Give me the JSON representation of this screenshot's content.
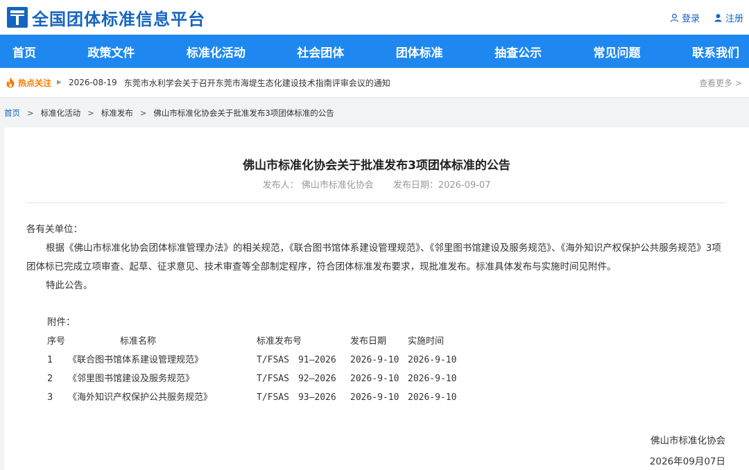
{
  "header": {
    "site_title": "全国团体标准信息平台",
    "login": "登录",
    "register": "注册"
  },
  "nav": [
    "首页",
    "政策文件",
    "标准化活动",
    "社会团体",
    "团体标准",
    "抽查公示",
    "常见问题",
    "联系我们"
  ],
  "hot": {
    "label": "热点关注",
    "date": "2026-08-19",
    "text": "东莞市水利学会关于召开东莞市海堤生态化建设技术指南评审会议的通知",
    "more": "查看更多 >"
  },
  "breadcrumb": [
    "首页",
    "标准化活动",
    "标准发布",
    "佛山市标准化协会关于批准发布3项团体标准的公告"
  ],
  "article": {
    "title": "佛山市标准化协会关于批准发布3项团体标准的公告",
    "publisher": "发布人： 佛山市标准化协会",
    "publish_date": "发布日期：2026-09-07",
    "salutation": "各有关单位：",
    "paragraph": "根据《佛山市标准化协会团体标准管理办法》的相关规范，《联合图书馆体系建设管理规范》、《邻里图书馆建设及服务规范》、《海外知识产权保护公共服务规范》3项团体标已完成立项审查、起草、征求意见、技术审查等全部制定程序，符合团体标准发布要求，现批准发布。标准具体发布与实施时间见附件。",
    "closing": "特此公告。",
    "attachment_label": "附件：",
    "table_headers": [
      "序号",
      "标准名称",
      "标准发布号",
      "发布日期",
      "实施时间"
    ],
    "rows": [
      [
        "1",
        "《联合图书馆体系建设管理规范》",
        "T/FSAS　91—2026",
        "2026-9-10",
        "2026-9-10"
      ],
      [
        "2",
        "《邻里图书馆建设及服务规范》",
        "T/FSAS　92—2026",
        "2026-9-10",
        "2026-9-10"
      ],
      [
        "3",
        "《海外知识产权保护公共服务规范》",
        "T/FSAS　93—2026",
        "2026-9-10",
        "2026-9-10"
      ]
    ],
    "signature": "佛山市标准化协会",
    "signature_date": "2026年09月07日"
  }
}
